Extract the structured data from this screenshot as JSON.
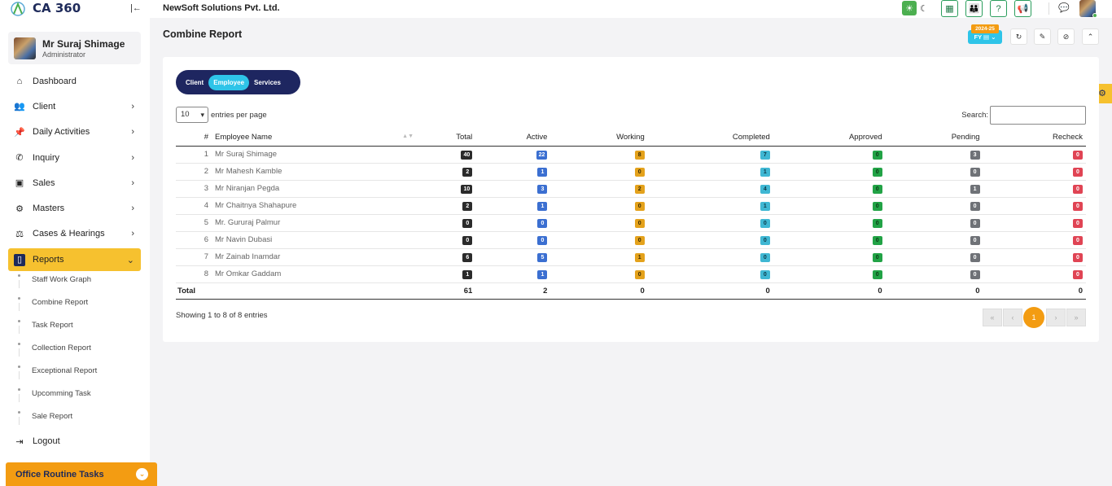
{
  "app": {
    "logo_text": "CA 360",
    "company": "NewSoft Solutions Pvt. Ltd."
  },
  "user": {
    "name": "Mr Suraj Shimage",
    "role": "Administrator"
  },
  "nav": [
    {
      "label": "Dashboard",
      "icon": "home-icon",
      "has_children": false
    },
    {
      "label": "Client",
      "icon": "users-icon",
      "has_children": true
    },
    {
      "label": "Daily Activities",
      "icon": "pin-icon",
      "has_children": true
    },
    {
      "label": "Inquiry",
      "icon": "phone-icon",
      "has_children": true
    },
    {
      "label": "Sales",
      "icon": "money-icon",
      "has_children": true
    },
    {
      "label": "Masters",
      "icon": "cogs-icon",
      "has_children": true
    },
    {
      "label": "Cases & Hearings",
      "icon": "scale-icon",
      "has_children": true
    },
    {
      "label": "Reports",
      "icon": "file-icon",
      "has_children": true,
      "active": true
    }
  ],
  "reports_sub": [
    "Staff Work Graph",
    "Combine Report",
    "Task Report",
    "Collection Report",
    "Exceptional Report",
    "Upcomming Task",
    "Sale Report"
  ],
  "logout_label": "Logout",
  "routine_label": "Office Routine Tasks",
  "page_title": "Combine Report",
  "fy": {
    "year": "2024-25",
    "label": "FY"
  },
  "tabs": [
    "Client",
    "Employee",
    "Services"
  ],
  "active_tab": "Employee",
  "length": {
    "value": "10",
    "suffix": "entries per page"
  },
  "search_label": "Search:",
  "columns": [
    "#",
    "Employee Name",
    "Total",
    "Active",
    "Working",
    "Completed",
    "Approved",
    "Pending",
    "Recheck"
  ],
  "rows": [
    {
      "idx": "1",
      "name": "Mr Suraj Shimage",
      "total": "40",
      "active": "22",
      "working": "8",
      "completed": "7",
      "approved": "0",
      "pending": "3",
      "recheck": "0"
    },
    {
      "idx": "2",
      "name": "Mr Mahesh Kamble",
      "total": "2",
      "active": "1",
      "working": "0",
      "completed": "1",
      "approved": "0",
      "pending": "0",
      "recheck": "0"
    },
    {
      "idx": "3",
      "name": "Mr Niranjan Pegda",
      "total": "10",
      "active": "3",
      "working": "2",
      "completed": "4",
      "approved": "0",
      "pending": "1",
      "recheck": "0"
    },
    {
      "idx": "4",
      "name": "Mr Chaitnya Shahapure",
      "total": "2",
      "active": "1",
      "working": "0",
      "completed": "1",
      "approved": "0",
      "pending": "0",
      "recheck": "0"
    },
    {
      "idx": "5",
      "name": "Mr. Gururaj Palmur",
      "total": "0",
      "active": "0",
      "working": "0",
      "completed": "0",
      "approved": "0",
      "pending": "0",
      "recheck": "0"
    },
    {
      "idx": "6",
      "name": "Mr Navin Dubasi",
      "total": "0",
      "active": "0",
      "working": "0",
      "completed": "0",
      "approved": "0",
      "pending": "0",
      "recheck": "0"
    },
    {
      "idx": "7",
      "name": "Mr Zainab Inamdar",
      "total": "6",
      "active": "5",
      "working": "1",
      "completed": "0",
      "approved": "0",
      "pending": "0",
      "recheck": "0"
    },
    {
      "idx": "8",
      "name": "Mr Omkar Gaddam",
      "total": "1",
      "active": "1",
      "working": "0",
      "completed": "0",
      "approved": "0",
      "pending": "0",
      "recheck": "0"
    }
  ],
  "totals": {
    "label": "Total",
    "total": "61",
    "active": "2",
    "working": "0",
    "completed": "0",
    "approved": "0",
    "pending": "0",
    "recheck": "0"
  },
  "info_text": "Showing 1 to 8 of 8 entries",
  "pagination": {
    "first": "«",
    "prev": "‹",
    "current": "1",
    "next": "›",
    "last": "»"
  },
  "colors": {
    "navy": "#1e2660",
    "accent_yellow": "#f6c12f",
    "orange": "#f39c12",
    "cyan": "#2ec4e8"
  }
}
